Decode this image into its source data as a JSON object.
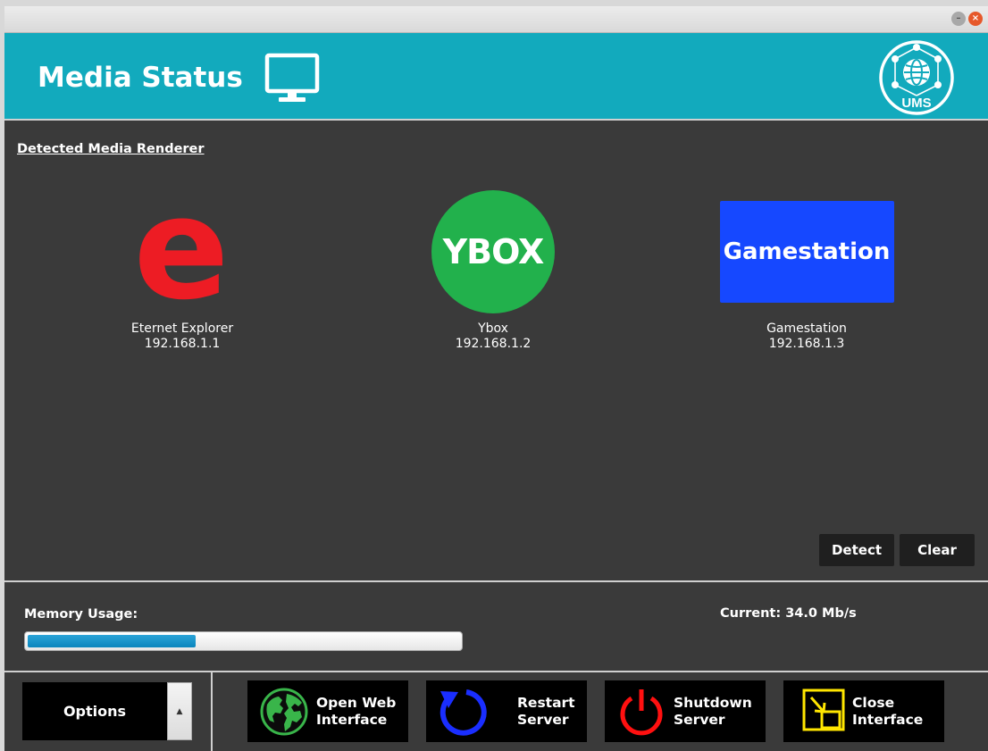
{
  "header": {
    "title": "Media Status",
    "logo_text": "UMS"
  },
  "renderers_section": {
    "title": "Detected Media Renderer",
    "renderers": [
      {
        "name": "Eternet Explorer",
        "ip": "192.168.1.1",
        "logo_text": "e"
      },
      {
        "name": "Ybox",
        "ip": "192.168.1.2",
        "logo_text": "YBOX"
      },
      {
        "name": "Gamestation",
        "ip": "192.168.1.3",
        "logo_text": "Gamestation"
      }
    ],
    "detect_label": "Detect",
    "clear_label": "Clear"
  },
  "memory": {
    "label": "Memory Usage:",
    "current": "Current: 34.0 Mb/s",
    "usage_fraction": 0.39
  },
  "footer": {
    "options_label": "Options",
    "buttons": [
      {
        "label": "Open Web\nInterface",
        "icon": "globe-icon"
      },
      {
        "label": "Restart\nServer",
        "icon": "restart-icon"
      },
      {
        "label": "Shutdown\nServer",
        "icon": "power-icon"
      },
      {
        "label": "Close\nInterface",
        "icon": "minimize-window-icon"
      }
    ]
  },
  "colors": {
    "header_bg": "#12aabd",
    "body_bg": "#3a3a3a",
    "ybox_green": "#22b14c",
    "gamestation_blue": "#1648ff",
    "explorer_red": "#ed1c24",
    "memory_fill": "#0a86bd"
  }
}
